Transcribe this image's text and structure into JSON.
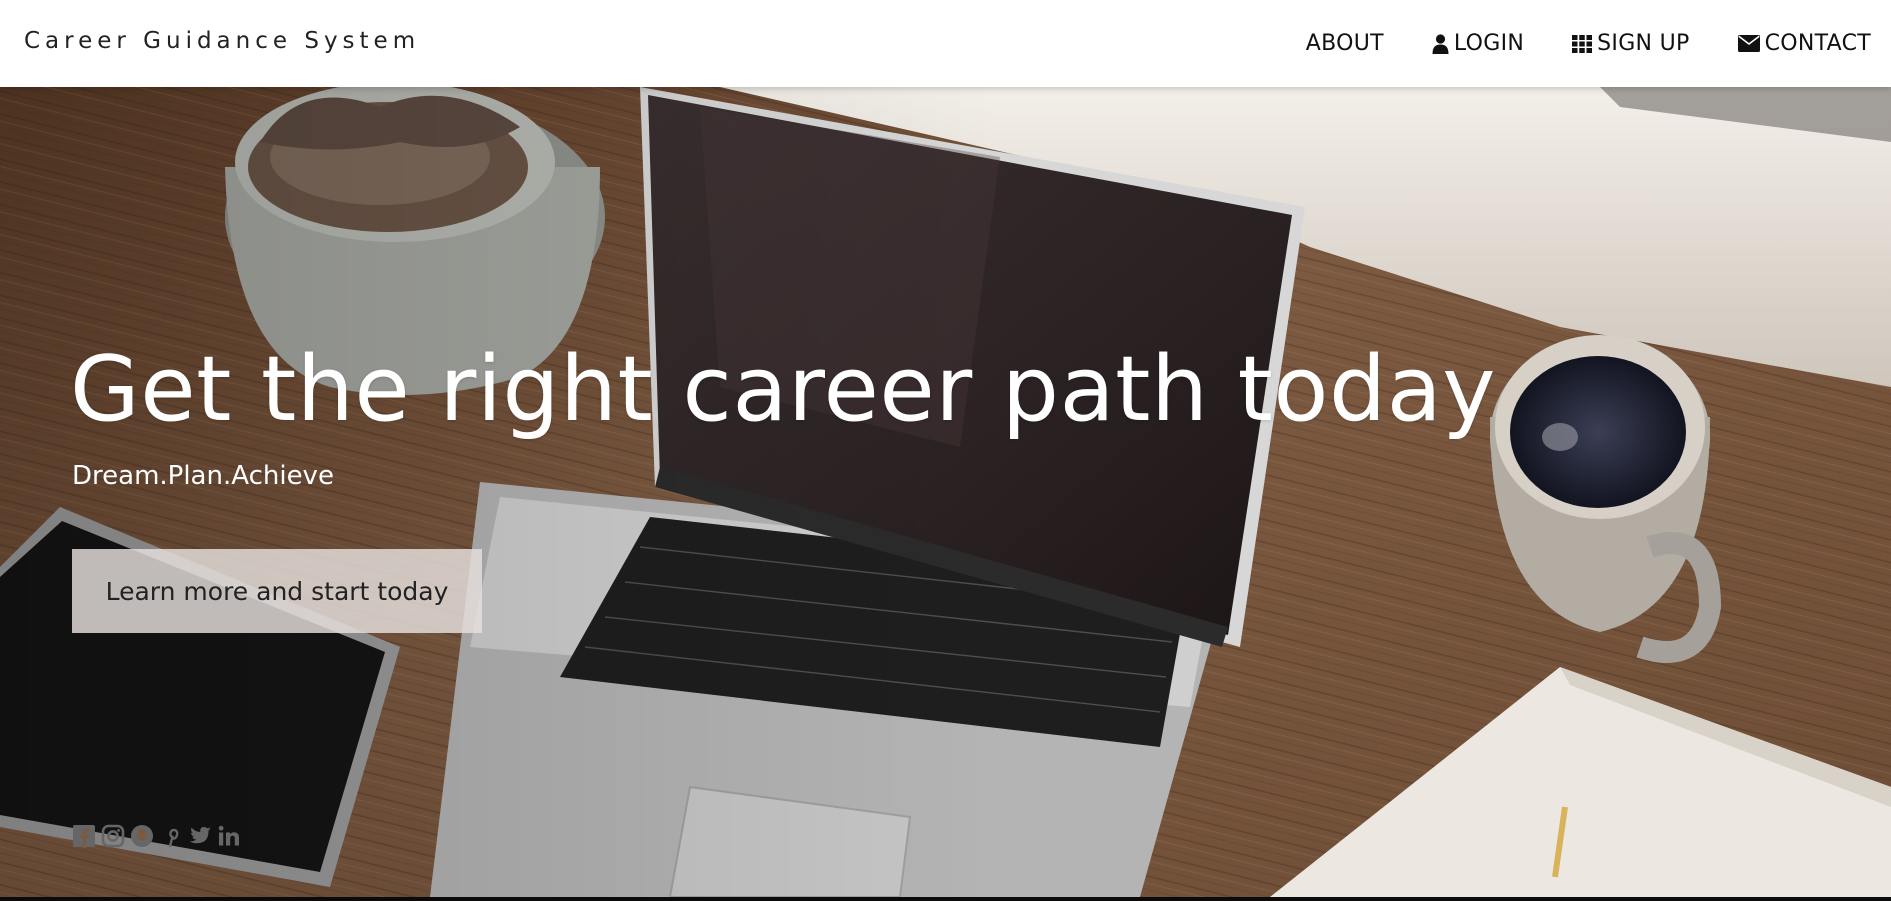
{
  "brand": {
    "title": "Career Guidance System"
  },
  "nav": {
    "items": [
      {
        "label": "ABOUT",
        "icon": ""
      },
      {
        "label": "LOGIN",
        "icon": "user-icon"
      },
      {
        "label": "SIGN UP",
        "icon": "grid-icon"
      },
      {
        "label": "CONTACT",
        "icon": "envelope-icon"
      }
    ]
  },
  "hero": {
    "title": "Get the right career path today",
    "subtitle": "Dream.Plan.Achieve",
    "cta_label": "Learn more and start today"
  },
  "social": {
    "icons": [
      "facebook-icon",
      "instagram-icon",
      "snapchat-icon",
      "pinterest-icon",
      "twitter-icon",
      "linkedin-icon"
    ]
  },
  "colors": {
    "nav_bg": "#ffffff",
    "hero_text": "#ffffff",
    "cta_bg": "#e6e1de",
    "social_icon": "#666666"
  }
}
